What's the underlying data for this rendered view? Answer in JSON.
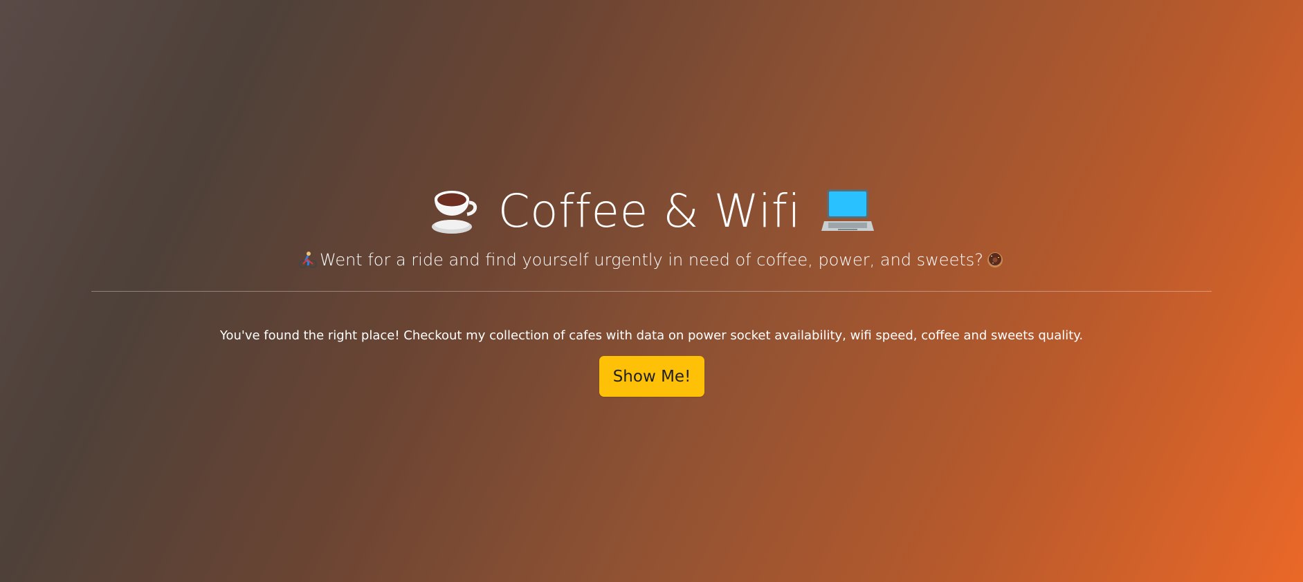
{
  "hero": {
    "title": "Coffee & Wifi",
    "leading_icon": "coffee-cup-icon",
    "trailing_icon": "laptop-icon",
    "subtitle": "Went for a ride and find yourself urgently in need of coffee, power, and sweets?",
    "subtitle_leading_icon": "cyclist-icon",
    "subtitle_trailing_icon": "donut-icon"
  },
  "content": {
    "lead_text": "You've found the right place! Checkout my collection of cafes with data on power socket availability, wifi speed, coffee and sweets quality."
  },
  "cta": {
    "label": "Show Me!",
    "color": "#ffc107"
  },
  "theme": {
    "background_gradient_start": "#5a4a47",
    "background_gradient_end": "#ea6828"
  }
}
